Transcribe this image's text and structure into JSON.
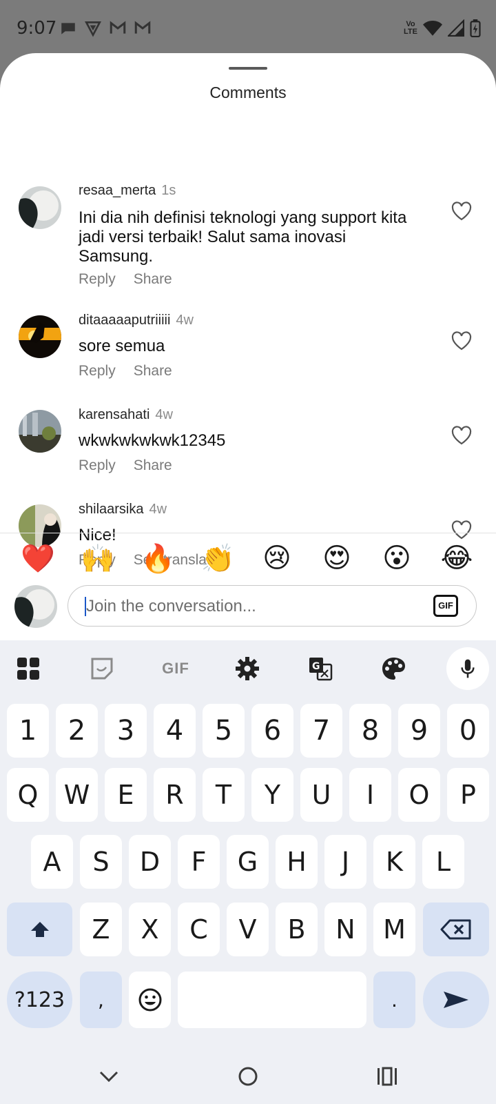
{
  "status_bar": {
    "time": "9:07",
    "left_icons": [
      "message-icon",
      "shield-app-icon",
      "gmail-icon",
      "gmail-icon"
    ],
    "right_icons": [
      "volte-icon",
      "wifi-icon",
      "signal-icon",
      "battery-charging-icon"
    ],
    "volte_top": "Vo",
    "volte_bottom": "LTE"
  },
  "sheet": {
    "title": "Comments"
  },
  "comments": [
    {
      "username": "resaa_merta",
      "time": "1s",
      "text": "Ini dia nih definisi teknologi yang support kita jadi versi terbaik! Salut sama inovasi Samsung.",
      "actions": [
        "Reply",
        "Share"
      ]
    },
    {
      "username": "ditaaaaaputriiiii",
      "time": "4w",
      "text": "sore semua",
      "actions": [
        "Reply",
        "Share"
      ]
    },
    {
      "username": "karensahati",
      "time": "4w",
      "text": "wkwkwkwkwk12345",
      "actions": [
        "Reply",
        "Share"
      ]
    },
    {
      "username": "shilaarsika",
      "time": "4w",
      "text": "Nice!",
      "actions": [
        "Reply",
        "See translation"
      ]
    }
  ],
  "quick_reactions": [
    "❤️",
    "🙌",
    "🔥",
    "👏",
    "😢",
    "😍",
    "😮",
    "😂"
  ],
  "composer": {
    "placeholder": "Join the conversation...",
    "gif_label": "GIF"
  },
  "keyboard": {
    "toolbar": [
      "apps-grid-icon",
      "sticker-icon",
      "gif-icon",
      "settings-gear-icon",
      "translate-icon",
      "theme-palette-icon",
      "microphone-icon"
    ],
    "toolbar_gif_label": "GIF",
    "number_row": [
      "1",
      "2",
      "3",
      "4",
      "5",
      "6",
      "7",
      "8",
      "9",
      "0"
    ],
    "row1": [
      "Q",
      "W",
      "E",
      "R",
      "T",
      "Y",
      "U",
      "I",
      "O",
      "P"
    ],
    "row2": [
      "A",
      "S",
      "D",
      "F",
      "G",
      "H",
      "J",
      "K",
      "L"
    ],
    "row3": [
      "Z",
      "X",
      "C",
      "V",
      "B",
      "N",
      "M"
    ],
    "symbols_label": "?123",
    "comma": ",",
    "period": ".",
    "accent_color": "#d8e2f4"
  },
  "nav_bar": {
    "buttons": [
      "back-chevron-icon",
      "home-icon",
      "recents-icon"
    ]
  }
}
